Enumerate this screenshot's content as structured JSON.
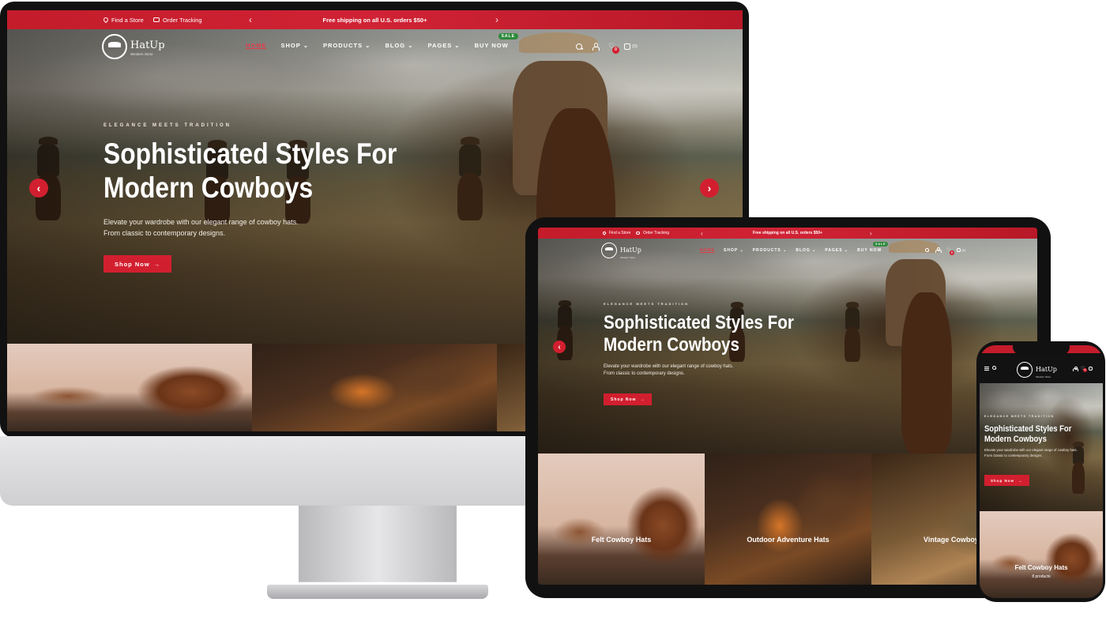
{
  "topbar": {
    "find_store": "Find a Store",
    "order_tracking": "Order Tracking",
    "shipping_notice": "Free shipping on all U.S. orders $50+",
    "prev_icon": "chevron-left-icon",
    "next_icon": "chevron-right-icon"
  },
  "brand": {
    "name": "HatUp",
    "tagline": "Western Store"
  },
  "nav": {
    "home": "HOME",
    "shop": "SHOP",
    "products": "PRODUCTS",
    "blog": "BLOG",
    "pages": "PAGES",
    "buy_now": "BUY NOW",
    "sale_badge": "Sale"
  },
  "header_icons": {
    "wishlist_count": "0",
    "cart_count": "(0)"
  },
  "hero": {
    "eyebrow": "ELEGANCE MEETS TRADITION",
    "headline_line1": "Sophisticated Styles For",
    "headline_line2": "Modern Cowboys",
    "subcopy_line1": "Elevate your wardrobe with our elegant range of cowboy hats.",
    "subcopy_line2": "From classic to contemporary designs.",
    "cta": "Shop Now",
    "cta_arrow": "→",
    "prev_arrow": "‹",
    "next_arrow": "›"
  },
  "categories": [
    {
      "name": "Felt Cowboy Hats",
      "count": "8 products"
    },
    {
      "name": "Outdoor Adventure Hats"
    },
    {
      "name": "Vintage Cowboy Ha"
    }
  ],
  "colors": {
    "accent": "#d21f2f",
    "sale_badge": "#2f8a3c"
  }
}
